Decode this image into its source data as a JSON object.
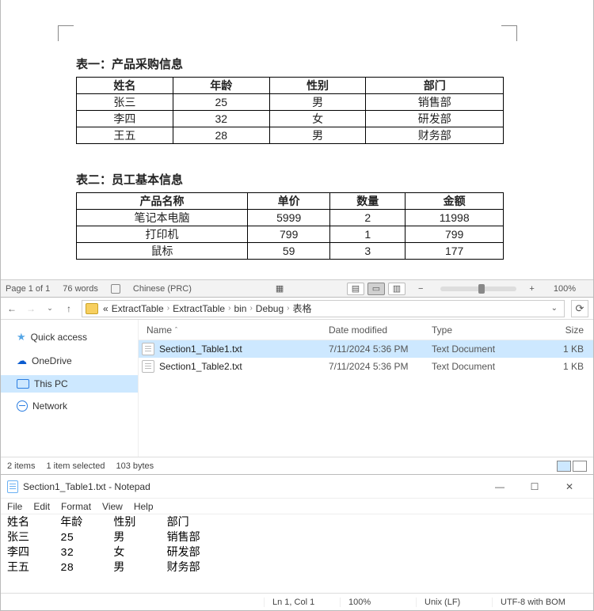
{
  "doc": {
    "table1": {
      "title": "表一：产品采购信息",
      "headers": [
        "姓名",
        "年龄",
        "性别",
        "部门"
      ],
      "rows": [
        [
          "张三",
          "25",
          "男",
          "销售部"
        ],
        [
          "李四",
          "32",
          "女",
          "研发部"
        ],
        [
          "王五",
          "28",
          "男",
          "财务部"
        ]
      ]
    },
    "table2": {
      "title": "表二：员工基本信息",
      "headers": [
        "产品名称",
        "单价",
        "数量",
        "金额"
      ],
      "rows": [
        [
          "笔记本电脑",
          "5999",
          "2",
          "11998"
        ],
        [
          "打印机",
          "799",
          "1",
          "799"
        ],
        [
          "鼠标",
          "59",
          "3",
          "177"
        ]
      ]
    }
  },
  "word_status": {
    "page": "Page 1 of 1",
    "words": "76 words",
    "language": "Chinese (PRC)",
    "zoom_minus": "−",
    "zoom_plus": "+",
    "zoom_pct": "100%"
  },
  "explorer": {
    "breadcrumb": {
      "ellipsis": "«",
      "parts": [
        "ExtractTable",
        "ExtractTable",
        "bin",
        "Debug",
        "表格"
      ]
    },
    "columns": {
      "name": "Name",
      "date": "Date modified",
      "type": "Type",
      "size": "Size"
    },
    "files": [
      {
        "name": "Section1_Table1.txt",
        "date": "7/11/2024 5:36 PM",
        "type": "Text Document",
        "size": "1 KB",
        "selected": true
      },
      {
        "name": "Section1_Table2.txt",
        "date": "7/11/2024 5:36 PM",
        "type": "Text Document",
        "size": "1 KB",
        "selected": false
      }
    ],
    "sidebar": {
      "quick_access": "Quick access",
      "onedrive": "OneDrive",
      "this_pc": "This PC",
      "network": "Network"
    },
    "status": {
      "items": "2 items",
      "selected": "1 item selected",
      "bytes": "103 bytes"
    }
  },
  "notepad": {
    "title": "Section1_Table1.txt - Notepad",
    "menu": {
      "file": "File",
      "edit": "Edit",
      "format": "Format",
      "view": "View",
      "help": "Help"
    },
    "content": "姓名\t年龄\t性别\t部门\n张三\t25\t男\t销售部\n李四\t32\t女\t研发部\n王五\t28\t男\t财务部",
    "status": {
      "cursor": "Ln 1, Col 1",
      "zoom": "100%",
      "eol": "Unix (LF)",
      "encoding": "UTF-8 with BOM"
    }
  }
}
